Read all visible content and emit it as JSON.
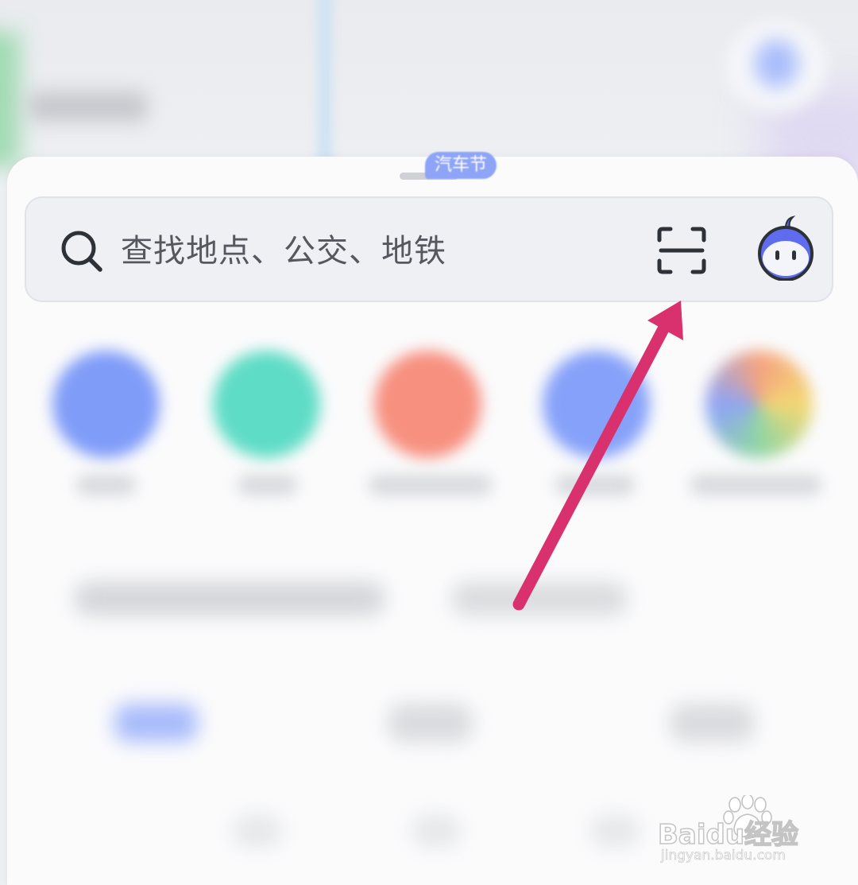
{
  "search": {
    "placeholder": "查找地点、公交、地铁",
    "icons": [
      "search-icon",
      "scan-icon",
      "assistant-icon"
    ]
  },
  "quick_entries": {
    "badge": "汽车节",
    "colors": [
      "#7f9cf8",
      "#5fdcc6",
      "#f7907f",
      "#86a1f9"
    ]
  },
  "annotation": {
    "arrow_color": "#d9306e",
    "target": "scan-icon"
  },
  "watermark": {
    "brand": "Baidu经验",
    "url": "jingyan.baidu.com"
  },
  "colors": {
    "sheet": "#fbfbfc",
    "search_bar": "#eef0f4",
    "icon_stroke": "#2d3138",
    "assistant_fill": "#5f6cf0"
  }
}
